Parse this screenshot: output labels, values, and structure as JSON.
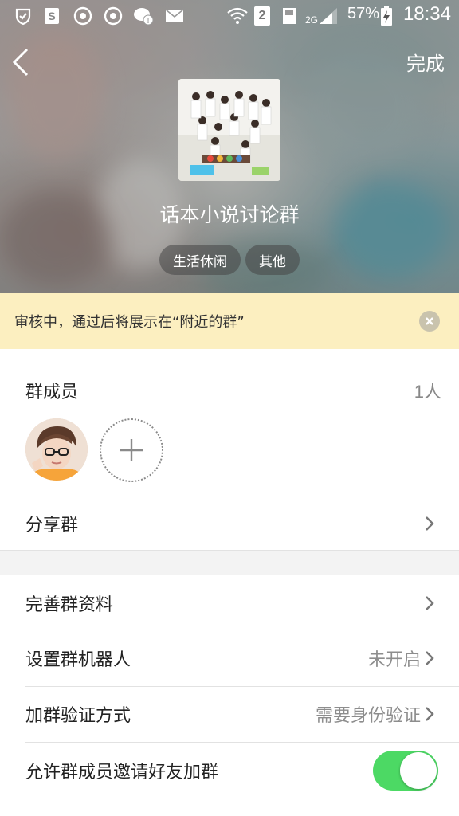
{
  "status_bar": {
    "sim_label": "2",
    "network": "2G",
    "battery": "57%",
    "time": "18:34"
  },
  "nav": {
    "done_label": "完成"
  },
  "group": {
    "name": "话本小说讨论群",
    "tags": [
      "生活休闲",
      "其他"
    ]
  },
  "notice": {
    "text": "审核中，通过后将展示在“附近的群”"
  },
  "members": {
    "title": "群成员",
    "count": "1人"
  },
  "rows": {
    "share": {
      "label": "分享群"
    },
    "profile": {
      "label": "完善群资料"
    },
    "robot": {
      "label": "设置群机器人",
      "value": "未开启"
    },
    "verify": {
      "label": "加群验证方式",
      "value": "需要身份验证"
    },
    "invite": {
      "label": "允许群成员邀请好友加群",
      "enabled": true
    }
  },
  "colors": {
    "toggle_on": "#4cd964",
    "notice_bg": "#fcefc0"
  },
  "icons": {
    "back": "chevron-left-icon",
    "close": "close-circle-icon",
    "add": "plus-icon",
    "row_arrow": "chevron-right-icon"
  }
}
